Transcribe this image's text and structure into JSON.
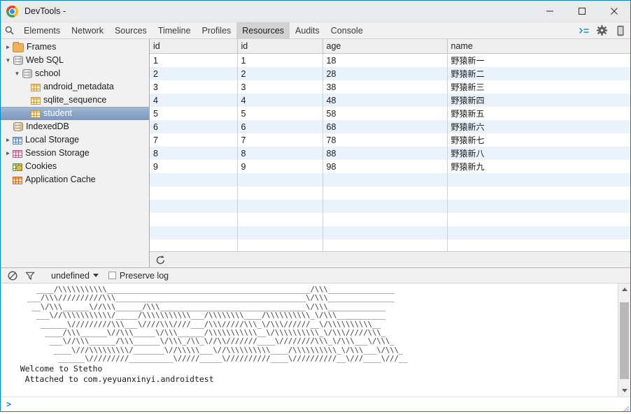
{
  "window": {
    "title": "DevTools -",
    "logo_icon": "chrome-logo",
    "minimize_label": "Minimize",
    "maximize_label": "Maximize",
    "close_label": "Close"
  },
  "toolbar": {
    "search_icon": "search-icon",
    "tabs": [
      {
        "label": "Elements",
        "active": false
      },
      {
        "label": "Network",
        "active": false
      },
      {
        "label": "Sources",
        "active": false
      },
      {
        "label": "Timeline",
        "active": false
      },
      {
        "label": "Profiles",
        "active": false
      },
      {
        "label": "Resources",
        "active": true
      },
      {
        "label": "Audits",
        "active": false
      },
      {
        "label": "Console",
        "active": false
      }
    ],
    "right_icons": [
      "console-prompt-icon",
      "gear-icon",
      "dock-device-icon"
    ]
  },
  "sidebar": {
    "items": [
      {
        "label": "Frames",
        "icon": "folder-icon",
        "indent": 0,
        "twisty": "collapsed",
        "selected": false
      },
      {
        "label": "Web SQL",
        "icon": "database-icon",
        "indent": 0,
        "twisty": "expanded",
        "selected": false
      },
      {
        "label": "school",
        "icon": "database-icon",
        "indent": 1,
        "twisty": "expanded",
        "selected": false
      },
      {
        "label": "android_metadata",
        "icon": "table-icon",
        "indent": 2,
        "twisty": "none",
        "selected": false
      },
      {
        "label": "sqlite_sequence",
        "icon": "table-icon",
        "indent": 2,
        "twisty": "none",
        "selected": false
      },
      {
        "label": "student",
        "icon": "table-icon",
        "indent": 2,
        "twisty": "none",
        "selected": true
      },
      {
        "label": "IndexedDB",
        "icon": "database-tan-icon",
        "indent": 0,
        "twisty": "none",
        "selected": false
      },
      {
        "label": "Local Storage",
        "icon": "table-blue-icon",
        "indent": 0,
        "twisty": "collapsed",
        "selected": false
      },
      {
        "label": "Session Storage",
        "icon": "table-pink-icon",
        "indent": 0,
        "twisty": "collapsed",
        "selected": false
      },
      {
        "label": "Cookies",
        "icon": "cookie-icon",
        "indent": 0,
        "twisty": "none",
        "selected": false
      },
      {
        "label": "Application Cache",
        "icon": "table-orange-icon",
        "indent": 0,
        "twisty": "none",
        "selected": false
      }
    ]
  },
  "datagrid": {
    "columns": [
      "id",
      "id",
      "age",
      "name"
    ],
    "rows": [
      [
        "1",
        "1",
        "18",
        "野猿新一"
      ],
      [
        "2",
        "2",
        "28",
        "野猿新二"
      ],
      [
        "3",
        "3",
        "38",
        "野猿新三"
      ],
      [
        "4",
        "4",
        "48",
        "野猿新四"
      ],
      [
        "5",
        "5",
        "58",
        "野猿新五"
      ],
      [
        "6",
        "6",
        "68",
        "野猿新六"
      ],
      [
        "7",
        "7",
        "78",
        "野猿新七"
      ],
      [
        "8",
        "8",
        "88",
        "野猿新八"
      ],
      [
        "9",
        "9",
        "98",
        "野猿新九"
      ]
    ],
    "empty_row_count": 9,
    "refresh_icon": "refresh-icon",
    "refresh_label": "Refresh"
  },
  "console": {
    "clear_icon": "clear-console-icon",
    "filter_icon": "filter-funnel-icon",
    "context_value": "undefined",
    "context_caret_icon": "chevron-down-icon",
    "preserve_log_label": "Preserve log",
    "preserve_log_checked": false,
    "prompt_symbol": ">",
    "ascii_art": "        ____/\\\\\\\\\\\\\\\\\\\\\\______________________________________________/\\\\\\_______________\n      ___/\\\\\\//////////\\\\\\___________________________________________\\/\\\\\\_______________\n       __\\/\\\\\\______\\//\\\\\\______/\\\\\\_________________________________\\/\\\\\\_____________\n        ___\\//\\\\\\\\\\\\\\\\\\\\\\/_____/\\\\\\\\\\\\\\\\\\\\\\___/\\\\\\\\\\\\\\\\____/\\\\\\\\\\\\\\\\\\\\_\\/\\\\\\___________\n         ______\\/////////\\\\\\___\\////\\\\\\////___/\\\\\\/////\\\\\\_\\/\\\\\\//////__\\/\\\\\\\\\\\\\\\\\\\\__\n          ____/\\\\\\______\\//\\\\\\_____\\/\\\\\\______/\\\\\\\\\\\\\\\\\\\\\\__\\/\\\\\\\\\\\\\\\\\\\\_\\/\\\\\\/////\\\\\\_\n           ___\\//\\\\\\______/\\\\\\______\\/\\\\\\_/\\\\_\\//\\\\///////____\\////////\\\\\\_\\/\\\\\\___\\/\\\\\\_\n            ____\\///\\\\\\\\\\\\\\\\\\/_______\\//\\\\\\\\\\___\\//\\\\\\\\\\\\\\\\\\\\____/\\\\\\\\\\\\\\\\\\\\_\\/\\\\\\___\\/\\\\\\_\n             ______\\/////////__________\\/////_____\\//////////____\\//////////__\\///____\\///__",
    "messages": [
      "    Welcome to Stetho",
      "     Attached to com.yeyuanxinyi.androidtest"
    ],
    "scroll": {
      "up_arrow_icon": "scroll-up-icon",
      "down_arrow_icon": "scroll-down-icon"
    }
  },
  "colors": {
    "accent_blue": "#0a81c6",
    "selection_blue": "#8ba5c6",
    "row_stripe": "#eaf3fc",
    "prompt_blue": "#2a7ede"
  }
}
